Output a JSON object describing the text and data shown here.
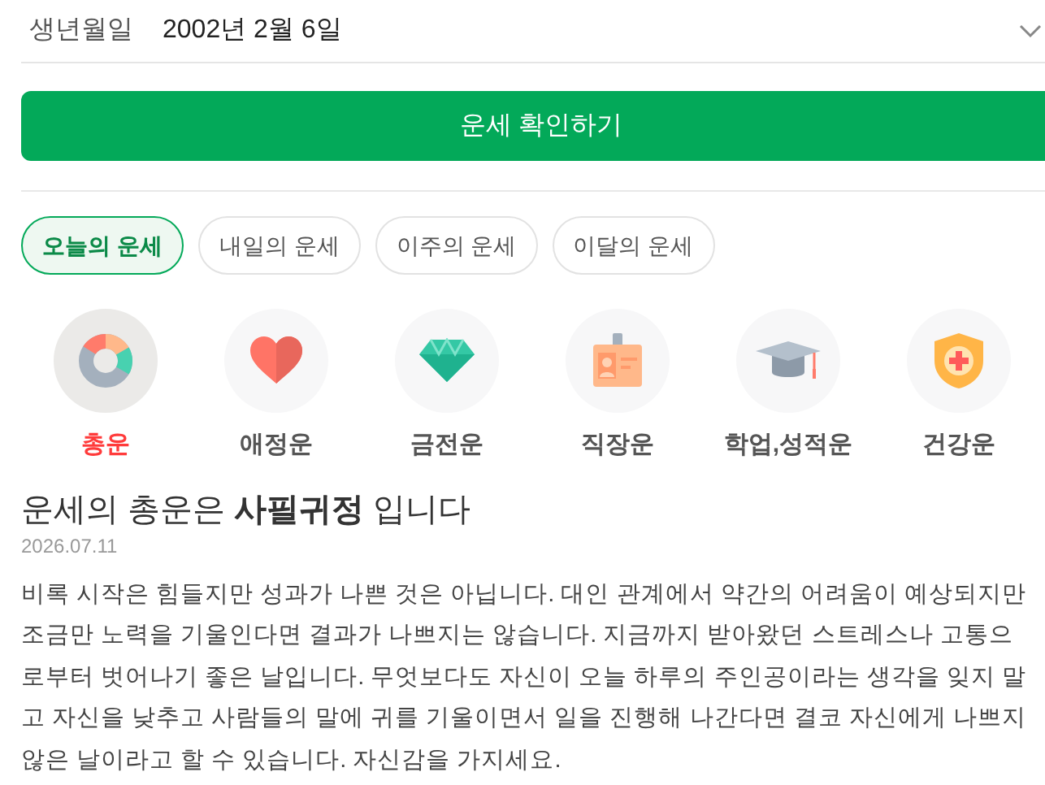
{
  "birth_field": {
    "label": "생년월일",
    "value": "2002년 2월 6일"
  },
  "confirm_button": "운세 확인하기",
  "tabs": [
    {
      "label": "오늘의 운세",
      "selected": true
    },
    {
      "label": "내일의 운세",
      "selected": false
    },
    {
      "label": "이주의 운세",
      "selected": false
    },
    {
      "label": "이달의 운세",
      "selected": false
    }
  ],
  "categories": [
    {
      "kind": "overall",
      "label": "총운",
      "selected": true
    },
    {
      "kind": "love",
      "label": "애정운",
      "selected": false
    },
    {
      "kind": "money",
      "label": "금전운",
      "selected": false
    },
    {
      "kind": "work",
      "label": "직장운",
      "selected": false
    },
    {
      "kind": "study",
      "label": "학업,성적운",
      "selected": false
    },
    {
      "kind": "health",
      "label": "건강운",
      "selected": false
    }
  ],
  "result": {
    "title": "운세의 총운은 **사필귀정** 입니다",
    "date": "2026.07.11",
    "text": "비록 시작은 힘들지만 성과가 나쁜 것은 아닙니다. 대인 관계에서 약간의 어려움이 예상되지만 조금만 노력을 기울인다면 결과가 나쁘지는 않습니다. 지금까지 받아왔던 스트레스나 고통으로부터 벗어나기 좋은 날입니다. 무엇보다도 자신이 오늘 하루의 주인공이라는 생각을 잊지 말고 자신을 낮추고 사람들의 말에 귀를 기울이면서 일을 진행해 나간다면 결코 자신에게 나쁘지 않은 날이라고 할 수 있습니다. 자신감을 가지세요."
  }
}
